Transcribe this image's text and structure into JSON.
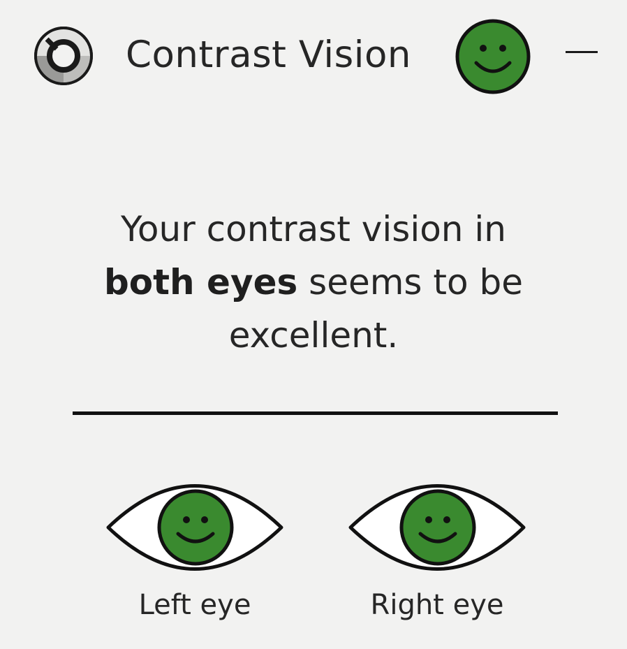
{
  "header": {
    "logo_icon": "contrast-ring-logo-icon",
    "title": "Contrast Vision",
    "status_icon": "smiley-face-icon",
    "status_color": "#3a8a2f",
    "collapse_icon": "minimize-icon"
  },
  "result": {
    "line1": "Your contrast vision in",
    "emphasis": "both eyes",
    "line2_rest": " seems to be",
    "line3": "excellent."
  },
  "eyes": [
    {
      "label": "Left eye",
      "icon": "eye-smiley-icon",
      "status_color": "#3a8a2f"
    },
    {
      "label": "Right eye",
      "icon": "eye-smiley-icon",
      "status_color": "#3a8a2f"
    }
  ]
}
